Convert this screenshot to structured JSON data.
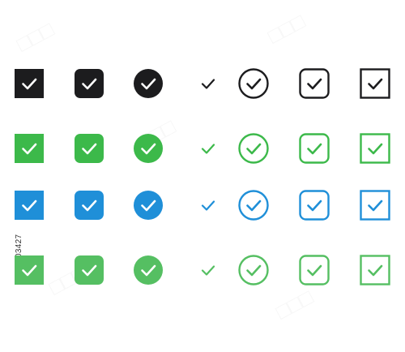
{
  "rows": [
    {
      "color": "#1c1c1e",
      "icons": [
        {
          "name": "black-filled-square-checkbox-icon",
          "variant": "filled-square"
        },
        {
          "name": "black-filled-rounded-square-check-icon",
          "variant": "filled-rounded"
        },
        {
          "name": "black-filled-circle-check-icon",
          "variant": "filled-circle"
        },
        {
          "name": "black-plain-checkmark-icon",
          "variant": "plain"
        },
        {
          "name": "black-outline-circle-check-icon",
          "variant": "outline-circle"
        },
        {
          "name": "black-outline-rounded-square-check-icon",
          "variant": "outline-rounded"
        },
        {
          "name": "black-outline-square-check-icon",
          "variant": "outline-square"
        }
      ]
    },
    {
      "color": "#3cb94a",
      "icons": [
        {
          "name": "green-filled-square-checkbox-icon",
          "variant": "filled-square"
        },
        {
          "name": "green-filled-rounded-square-check-icon",
          "variant": "filled-rounded"
        },
        {
          "name": "green-filled-circle-check-icon",
          "variant": "filled-circle"
        },
        {
          "name": "green-plain-checkmark-icon",
          "variant": "plain"
        },
        {
          "name": "green-outline-circle-check-icon",
          "variant": "outline-circle"
        },
        {
          "name": "green-outline-rounded-square-check-icon",
          "variant": "outline-rounded"
        },
        {
          "name": "green-outline-square-check-icon",
          "variant": "outline-square"
        }
      ]
    },
    {
      "color": "#1f8fd8",
      "icons": [
        {
          "name": "blue-filled-square-checkbox-icon",
          "variant": "filled-square"
        },
        {
          "name": "blue-filled-rounded-square-check-icon",
          "variant": "filled-rounded"
        },
        {
          "name": "blue-filled-circle-check-icon",
          "variant": "filled-circle"
        },
        {
          "name": "blue-plain-checkmark-icon",
          "variant": "plain"
        },
        {
          "name": "blue-outline-circle-check-icon",
          "variant": "outline-circle"
        },
        {
          "name": "blue-outline-rounded-square-check-icon",
          "variant": "outline-rounded"
        },
        {
          "name": "blue-outline-square-check-icon",
          "variant": "outline-square"
        }
      ]
    },
    {
      "color": "#55bf62",
      "icons": [
        {
          "name": "lightgreen-filled-square-checkbox-icon",
          "variant": "filled-square"
        },
        {
          "name": "lightgreen-filled-rounded-square-check-icon",
          "variant": "filled-rounded"
        },
        {
          "name": "lightgreen-filled-circle-check-icon",
          "variant": "filled-circle"
        },
        {
          "name": "lightgreen-plain-checkmark-icon",
          "variant": "plain"
        },
        {
          "name": "lightgreen-outline-circle-check-icon",
          "variant": "outline-circle"
        },
        {
          "name": "lightgreen-outline-rounded-square-check-icon",
          "variant": "outline-rounded"
        },
        {
          "name": "lightgreen-outline-square-check-icon",
          "variant": "outline-square"
        }
      ]
    }
  ],
  "stock_id": "1476603427",
  "watermark_text": "adobe stock"
}
